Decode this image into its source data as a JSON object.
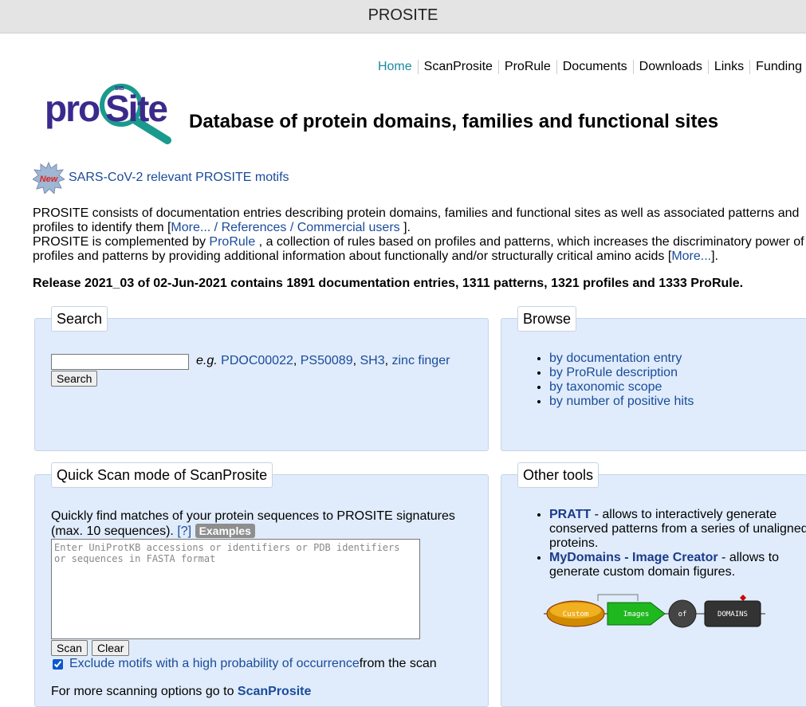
{
  "titlebar": {
    "title": "PROSITE"
  },
  "nav": [
    "Home",
    "ScanProsite",
    "ProRule",
    "Documents",
    "Downloads",
    "Links",
    "Funding"
  ],
  "logo": {
    "text": "prosite",
    "sub": "SIB"
  },
  "tagline": "Database of protein domains, families and functional sites",
  "new_badge": "New",
  "new_link": "SARS-CoV-2 relevant PROSITE motifs",
  "intro": {
    "p1": "PROSITE consists of documentation entries describing protein domains, families and functional sites as well as associated patterns and profiles to identify them [",
    "more1": "More...",
    "sep": " / ",
    "references": "References",
    "sep2": " / ",
    "commercial": "Commercial users",
    "p1_end": " ].",
    "p2_start": "PROSITE is complemented by ",
    "prorule": "ProRule",
    "p2_rest": " , a collection of rules based on profiles and patterns, which increases the discriminatory power of profiles and patterns by providing additional information about functionally and/or structurally critical amino acids [",
    "more2": "More...",
    "p2_end": "]."
  },
  "release": "Release 2021_03 of 02-Jun-2021 contains 1891 documentation entries, 1311 patterns, 1321 profiles and 1333 ProRule.",
  "search": {
    "legend": "Search",
    "eg_prefix": "e.g.",
    "examples": [
      "PDOC00022",
      "PS50089",
      "SH3",
      "zinc finger"
    ],
    "button": "Search"
  },
  "browse": {
    "legend": "Browse",
    "items": [
      "by documentation entry",
      "by ProRule description",
      "by taxonomic scope",
      "by number of positive hits"
    ]
  },
  "quickscan": {
    "legend": "Quick Scan mode of ScanProsite",
    "text": "Quickly find matches of your protein sequences to PROSITE signatures (max. 10 sequences).",
    "help": "[?]",
    "examples_btn": "Examples",
    "placeholder": "Enter UniProtKB accessions or identifiers or PDB identifiers or sequences in FASTA format",
    "scan_btn": "Scan",
    "clear_btn": "Clear",
    "exclude_link": "Exclude motifs with a high probability of occurrence",
    "exclude_rest": " from the scan",
    "more_prefix": "For more scanning options go to ",
    "more_link": "ScanProsite"
  },
  "tools": {
    "legend": "Other tools",
    "items": [
      {
        "name": "PRATT",
        "desc": " -  allows to interactively generate conserved patterns from a series of unaligned proteins."
      },
      {
        "name": "MyDomains - Image Creator",
        "desc": " -  allows to generate custom domain figures."
      }
    ],
    "image_labels": [
      "Custom",
      "Images",
      "of",
      "DOMAINS"
    ]
  },
  "colors": {
    "link": "#1a4b9a",
    "home": "#1a8aa0",
    "panel": "#e0ecfb",
    "logo_purple": "#3b2a8c",
    "logo_teal": "#1a9a8e"
  }
}
